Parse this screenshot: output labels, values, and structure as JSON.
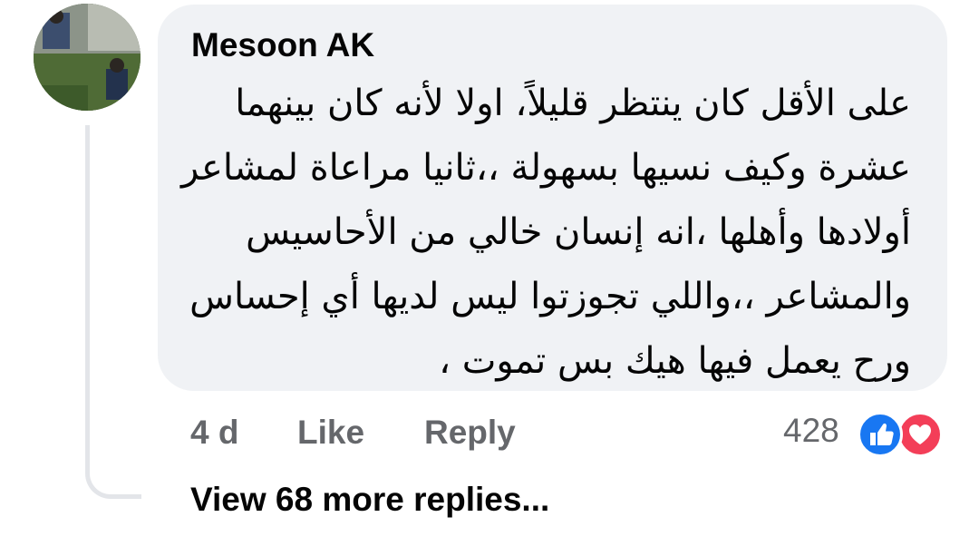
{
  "comment": {
    "author": "Mesoon AK",
    "text_lines": [
      "على الأقل كان ينتظر قليلاً، اولا لأنه كان بينهما",
      "عشرة وكيف نسيها بسهولة ،،ثانيا مراعاة لمشاعر",
      "أولادها وأهلها ،انه إنسان خالي من الأحاسيس",
      "والمشاعر ،،واللي تجوزتوا ليس لديها أي إحساس",
      "ورح يعمل فيها هيك بس تموت ،"
    ],
    "timestamp": "4 d",
    "like_label": "Like",
    "reply_label": "Reply",
    "reaction_count": "428",
    "reactions": [
      "like-icon",
      "love-icon"
    ],
    "view_replies_label": "View 68 more replies..."
  },
  "colors": {
    "bubble": "#f0f2f5",
    "secondary_text": "#65676b",
    "primary_text": "#050505",
    "like_blue": "#1877f2",
    "love_red": "#f33e58"
  }
}
